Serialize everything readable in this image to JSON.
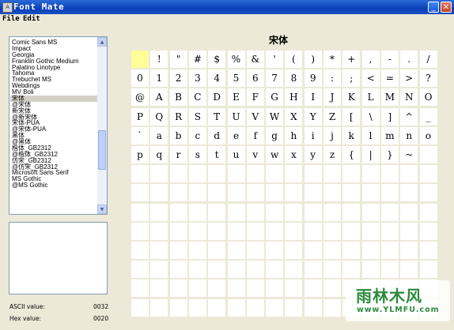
{
  "window": {
    "title": "Font Mate",
    "minimize": "_",
    "close": "✕"
  },
  "menu": [
    "File",
    "Edit"
  ],
  "font_list": [
    "Comic Sans MS",
    "Impact",
    "Georgia",
    "Franklin Gothic Medium",
    "Palatino Linotype",
    "Tahoma",
    "Trebuchet MS",
    "Webdings",
    "MV Boli",
    "宋体",
    "@宋体",
    "新宋体",
    "@新宋体",
    "宋体-PUA",
    "@宋体-PUA",
    "黑体",
    "@黑体",
    "楷体_GB2312",
    "@楷体_GB2312",
    "仿宋_GB2312",
    "@仿宋_GB2312",
    "Microsoft Sans Serif",
    "MS Gothic",
    "@MS Gothic"
  ],
  "selected_font": "宋体",
  "info": {
    "ascii_label": "ASCII value:",
    "ascii_value": "0032",
    "hex_label": "Hex value:",
    "hex_value": "0020"
  },
  "font_title": "宋体",
  "glyph_rows": [
    [
      "",
      "!",
      "\"",
      "#",
      "$",
      "%",
      "&",
      "'",
      "(",
      ")",
      "*",
      "+",
      ",",
      "-",
      ".",
      "/"
    ],
    [
      "0",
      "1",
      "2",
      "3",
      "4",
      "5",
      "6",
      "7",
      "8",
      "9",
      ":",
      ";",
      "<",
      "=",
      ">",
      "?"
    ],
    [
      "@",
      "A",
      "B",
      "C",
      "D",
      "E",
      "F",
      "G",
      "H",
      "I",
      "J",
      "K",
      "L",
      "M",
      "N",
      "O"
    ],
    [
      "P",
      "Q",
      "R",
      "S",
      "T",
      "U",
      "V",
      "W",
      "X",
      "Y",
      "Z",
      "[",
      "\\",
      "]",
      "^",
      "_"
    ],
    [
      "`",
      "a",
      "b",
      "c",
      "d",
      "e",
      "f",
      "g",
      "h",
      "i",
      "j",
      "k",
      "l",
      "m",
      "n",
      "o"
    ],
    [
      "p",
      "q",
      "r",
      "s",
      "t",
      "u",
      "v",
      "w",
      "x",
      "y",
      "z",
      "{",
      "|",
      "}",
      "~",
      ""
    ]
  ],
  "grid": {
    "columns": 16,
    "rows": 14,
    "highlight_cell": 0
  },
  "watermark": {
    "text": "雨林木风",
    "url": "www.YLMFU.com"
  },
  "icons": {
    "minimize": "minimize-icon",
    "close": "close-icon",
    "scroll_up": "scroll-up-icon",
    "scroll_down": "scroll-down-icon"
  }
}
